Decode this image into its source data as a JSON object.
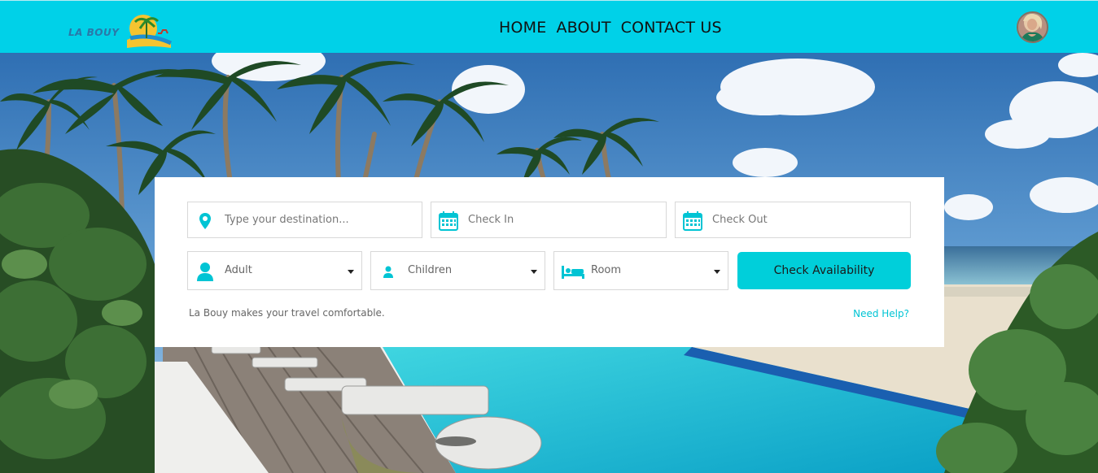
{
  "brand": {
    "logo_text": "LA BOUY",
    "accent_color": "#00d1e8",
    "button_color": "#00cfda",
    "link_color": "#00c4d4"
  },
  "nav": {
    "items": [
      {
        "label": "HOME"
      },
      {
        "label": "ABOUT"
      },
      {
        "label": "CONTACT US"
      }
    ]
  },
  "search": {
    "destination": {
      "placeholder": "Type your destination...",
      "icon": "map-pin-icon"
    },
    "check_in": {
      "placeholder": "Check In",
      "icon": "calendar-icon"
    },
    "check_out": {
      "placeholder": "Check Out",
      "icon": "calendar-icon"
    },
    "adult": {
      "label": "Adult",
      "icon": "person-icon"
    },
    "children": {
      "label": "Children",
      "icon": "child-icon"
    },
    "room": {
      "label": "Room",
      "icon": "bed-icon"
    },
    "submit_label": "Check Availability",
    "tagline": "La Bouy makes your travel comfortable.",
    "help_link": "Need Help?"
  }
}
